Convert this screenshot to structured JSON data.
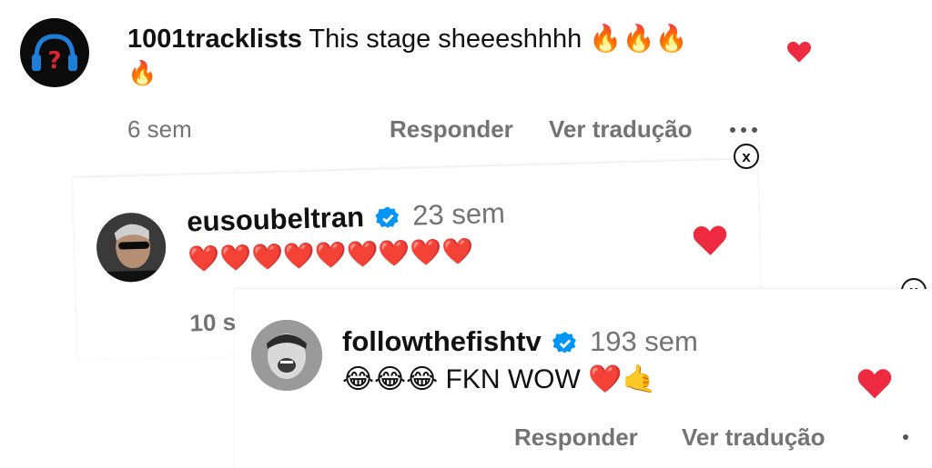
{
  "comment1": {
    "username": "1001tracklists",
    "text": "This stage sheeeshhhh 🔥🔥🔥",
    "text_cont": "🔥",
    "time": "6 sem",
    "reply_label": "Responder",
    "translate_label": "Ver tradução"
  },
  "comment2": {
    "username": "eusoubeltran",
    "time": "23 sem",
    "text": "❤️❤️❤️❤️❤️❤️❤️❤️❤️",
    "time_partial": "10 s"
  },
  "comment3": {
    "username": "followthefishtv",
    "time": "193 sem",
    "text": "😂😂😂 FKN WOW ❤️🤙",
    "reply_label": "Responder",
    "translate_label": "Ver tradução"
  },
  "close_glyph": "x",
  "colors": {
    "heart": "#ed2a3f",
    "verified": "#0095f6",
    "muted": "#737373"
  }
}
